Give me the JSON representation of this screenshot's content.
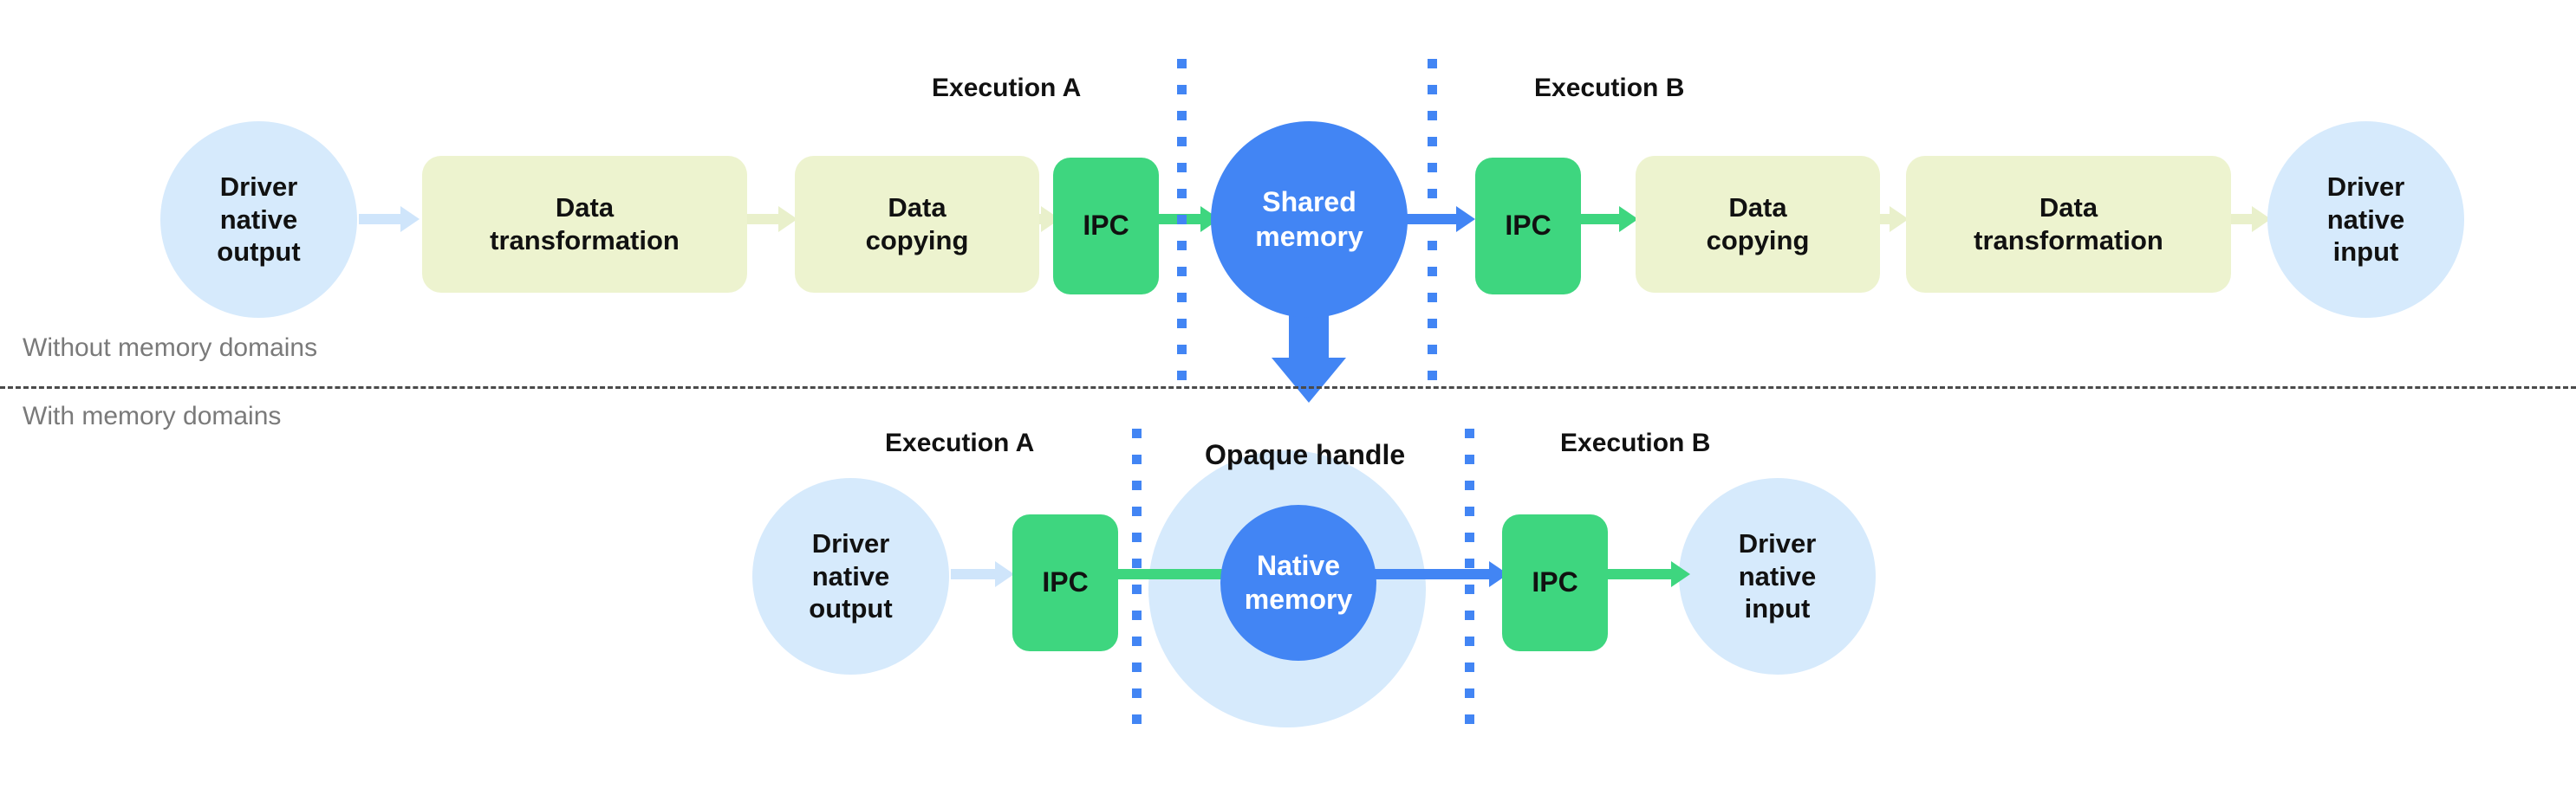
{
  "diagram": {
    "title_without": "Without memory domains",
    "title_with": "With memory domains",
    "colors": {
      "circle_light": "#d6eafc",
      "circle_blue": "#4285f4",
      "box_yellow": "#edf3cf",
      "box_green": "#3ed67f",
      "divider": "#4a4a4a",
      "side_label": "#7a7a7a",
      "dotted_boundary": "#4285f4"
    }
  },
  "top_row": {
    "execution_a_label": "Execution A",
    "execution_b_label": "Execution B",
    "nodes": [
      {
        "id": "driver-native-output",
        "label": "Driver\nnative\noutput",
        "line1": "Driver",
        "line2": "native",
        "line3": "output",
        "shape": "circle-light"
      },
      {
        "id": "data-transformation-out",
        "label": "Data transformation",
        "line1": "Data",
        "line2": "transformation",
        "shape": "box-yellow"
      },
      {
        "id": "data-copying-out",
        "label": "Data copying",
        "line1": "Data",
        "line2": "copying",
        "shape": "box-yellow"
      },
      {
        "id": "ipc-a",
        "label": "IPC",
        "shape": "box-green"
      },
      {
        "id": "shared-memory",
        "label": "Shared memory",
        "line1": "Shared",
        "line2": "memory",
        "shape": "circle-blue"
      },
      {
        "id": "ipc-b",
        "label": "IPC",
        "shape": "box-green"
      },
      {
        "id": "data-copying-in",
        "label": "Data copying",
        "line1": "Data",
        "line2": "copying",
        "shape": "box-yellow"
      },
      {
        "id": "data-transformation-in",
        "label": "Data transformation",
        "line1": "Data",
        "line2": "transformation",
        "shape": "box-yellow"
      },
      {
        "id": "driver-native-input",
        "label": "Driver\nnative\ninput",
        "line1": "Driver",
        "line2": "native",
        "line3": "input",
        "shape": "circle-light"
      }
    ]
  },
  "bottom_row": {
    "execution_a_label": "Execution A",
    "execution_b_label": "Execution B",
    "opaque_handle_label": "Opaque handle",
    "nodes": [
      {
        "id": "driver-native-output",
        "label": "Driver\nnative\noutput",
        "line1": "Driver",
        "line2": "native",
        "line3": "output",
        "shape": "circle-light"
      },
      {
        "id": "ipc-a",
        "label": "IPC",
        "shape": "box-green"
      },
      {
        "id": "native-memory",
        "label": "Native memory",
        "line1": "Native",
        "line2": "memory",
        "shape": "circle-blue"
      },
      {
        "id": "ipc-b",
        "label": "IPC",
        "shape": "box-green"
      },
      {
        "id": "driver-native-input",
        "label": "Driver\nnative\ninput",
        "line1": "Driver",
        "line2": "native",
        "line3": "input",
        "shape": "circle-light"
      }
    ]
  }
}
